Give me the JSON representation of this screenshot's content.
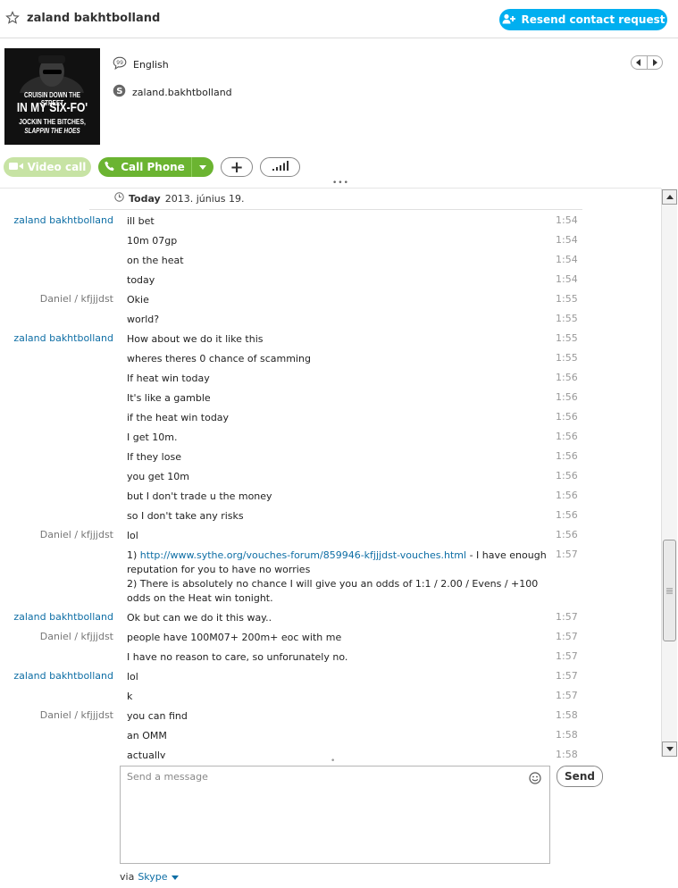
{
  "header": {
    "contact_name": "zaland bakhtbolland",
    "resend_label": "Resend contact request",
    "icons": {
      "star": "star-icon",
      "add_contact": "add-contact-icon"
    }
  },
  "profile": {
    "language": "English",
    "skype_id": "zaland.bakhtbolland",
    "avatar_text": {
      "line1": "CRUISIN DOWN THE STREET",
      "line2": "IN MY SIX-FO'",
      "line3": "JOCKIN THE BITCHES,",
      "line4": "SLAPPIN THE HOES"
    }
  },
  "actions": {
    "video_call": "Video call",
    "call_phone": "Call Phone",
    "add": "+"
  },
  "conversation": {
    "day_label": "Today",
    "day_date": "2013. június 19."
  },
  "messages": [
    {
      "sender": "zaland bakhtbolland",
      "who": "me",
      "text": "ill bet",
      "time": "1:54"
    },
    {
      "sender": "",
      "who": "me",
      "text": "10m 07gp",
      "time": "1:54"
    },
    {
      "sender": "",
      "who": "me",
      "text": "on the heat",
      "time": "1:54"
    },
    {
      "sender": "",
      "who": "me",
      "text": "today",
      "time": "1:54"
    },
    {
      "sender": "Daniel / kfjjjdst",
      "who": "other",
      "text": "Okie",
      "time": "1:55"
    },
    {
      "sender": "",
      "who": "other",
      "text": "world?",
      "time": "1:55"
    },
    {
      "sender": "zaland bakhtbolland",
      "who": "me",
      "text": "How about we do it like this",
      "time": "1:55"
    },
    {
      "sender": "",
      "who": "me",
      "text": "wheres theres 0 chance of scamming",
      "time": "1:55"
    },
    {
      "sender": "",
      "who": "me",
      "text": "If heat win today",
      "time": "1:56"
    },
    {
      "sender": "",
      "who": "me",
      "text": "It's like a gamble",
      "time": "1:56"
    },
    {
      "sender": "",
      "who": "me",
      "text": "if the heat win today",
      "time": "1:56"
    },
    {
      "sender": "",
      "who": "me",
      "text": "I get 10m.",
      "time": "1:56"
    },
    {
      "sender": "",
      "who": "me",
      "text": "If they lose",
      "time": "1:56"
    },
    {
      "sender": "",
      "who": "me",
      "text": "you get 10m",
      "time": "1:56"
    },
    {
      "sender": "",
      "who": "me",
      "text": "but I don't trade u the money",
      "time": "1:56"
    },
    {
      "sender": "",
      "who": "me",
      "text": "so I don't take any risks",
      "time": "1:56"
    },
    {
      "sender": "Daniel / kfjjjdst",
      "who": "other",
      "text": "lol",
      "time": "1:56"
    },
    {
      "sender": "",
      "who": "other",
      "pre": "1) ",
      "link": "http://www.sythe.org/vouches-forum/859946-kfjjjdst-vouches.html",
      "post": " - I have enough reputation for you to have no worries",
      "text2": "2) There is absolutely no chance I will give you an odds of 1:1 / 2.00 / Evens / +100 odds on the Heat win tonight.",
      "time": "1:57"
    },
    {
      "sender": "zaland bakhtbolland",
      "who": "me",
      "text": "Ok but can we do it this way..",
      "time": "1:57"
    },
    {
      "sender": "Daniel / kfjjjdst",
      "who": "other",
      "text": "people have 100M07+ 200m+ eoc with me",
      "time": "1:57"
    },
    {
      "sender": "",
      "who": "other",
      "text": "I have no reason to care, so unforunately no.",
      "time": "1:57"
    },
    {
      "sender": "zaland bakhtbolland",
      "who": "me",
      "text": "lol",
      "time": "1:57"
    },
    {
      "sender": "",
      "who": "me",
      "text": "k",
      "time": "1:57"
    },
    {
      "sender": "Daniel / kfjjjdst",
      "who": "other",
      "text": "you can find",
      "time": "1:58"
    },
    {
      "sender": "",
      "who": "other",
      "text": "an OMM",
      "time": "1:58"
    },
    {
      "sender": "",
      "who": "other",
      "text": "actually",
      "time": "1:58"
    }
  ],
  "composer": {
    "placeholder": "Send a message",
    "send_label": "Send",
    "via_label": "via",
    "via_service": "Skype"
  },
  "colors": {
    "accent": "#00aff0",
    "call_green": "#6bb431",
    "video_green_disabled": "#c7e3a4",
    "sender_self": "#0e6ea5",
    "sender_other": "#777777"
  }
}
